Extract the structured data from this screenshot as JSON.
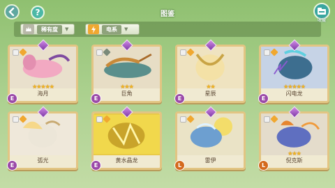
{
  "header": {
    "title": "图鉴",
    "help_label": "?",
    "collect_label": "收藏"
  },
  "filters": {
    "rarity": {
      "label": "稀有度",
      "arrow": "▼"
    },
    "element": {
      "label": "电系",
      "arrow": "▼"
    }
  },
  "cards": [
    {
      "name": "海月",
      "stars": "★★★★★",
      "grade": "E",
      "grade_color": "#9b4aa8",
      "bg": "#e9e0cc",
      "element_color": "#f0a830"
    },
    {
      "name": "巨角",
      "stars": "★★★",
      "grade": "E",
      "grade_color": "#9b4aa8",
      "bg": "#e7ddc5",
      "element_color": "#7a8a7a"
    },
    {
      "name": "星辰",
      "stars": "★★",
      "grade": "E",
      "grade_color": "#9b4aa8",
      "bg": "#efe3c0",
      "element_color": "#f0a830"
    },
    {
      "name": "闪电龙",
      "stars": "★★★★★",
      "grade": "E",
      "grade_color": "#9b4aa8",
      "bg": "#c6d3e6",
      "element_color": "#f0a830"
    },
    {
      "name": "弧光",
      "stars": "",
      "grade": "E",
      "grade_color": "#9b4aa8",
      "bg": "#efe8da",
      "element_color": "#f0a830"
    },
    {
      "name": "黄水晶龙",
      "stars": "",
      "grade": "E",
      "grade_color": "#9b4aa8",
      "bg": "#e8c846",
      "element_color": "#f0a830"
    },
    {
      "name": "雷伊",
      "stars": "",
      "grade": "L",
      "grade_color": "#d46a1e",
      "bg": "#eae3c6",
      "element_color": "#f0a830"
    },
    {
      "name": "倪克斯",
      "stars": "★★★",
      "grade": "L",
      "grade_color": "#d46a1e",
      "bg": "#e4dccb",
      "element_color": "#f0a830"
    }
  ]
}
